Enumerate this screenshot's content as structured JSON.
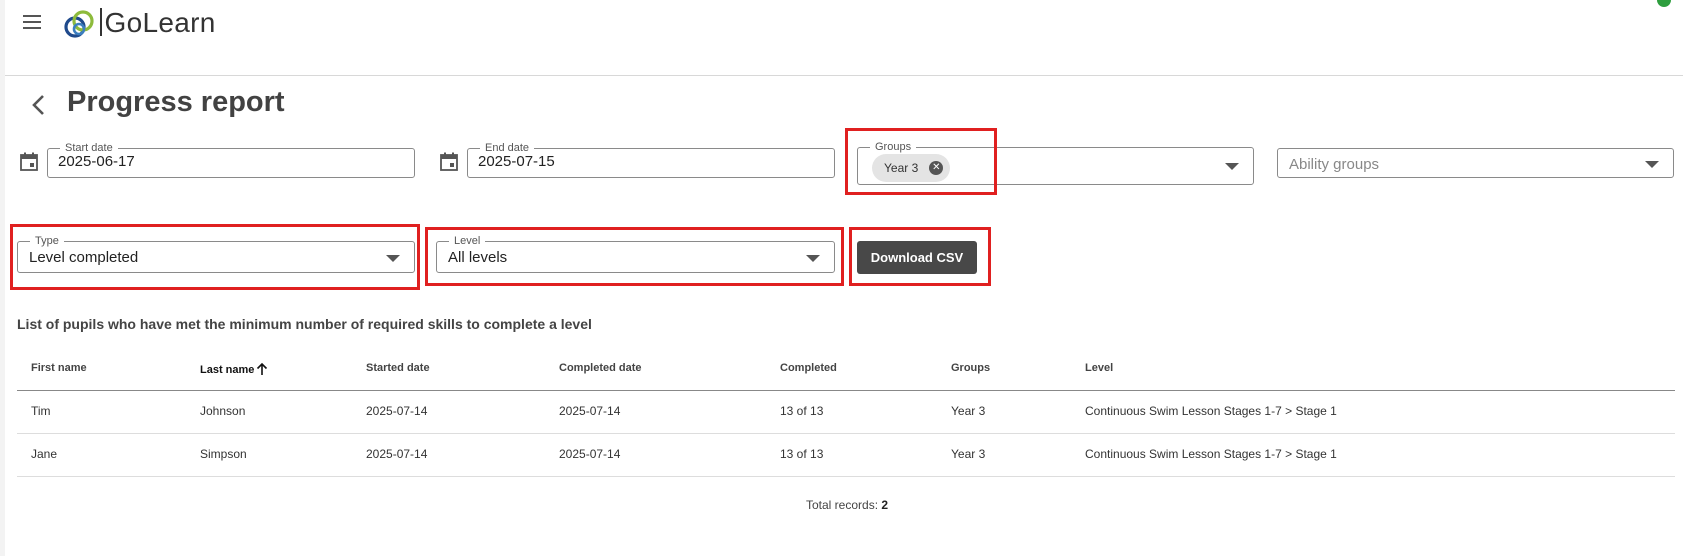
{
  "app": {
    "logo_text": "GoLearn",
    "accent_color": "#e02020",
    "status_color": "#2e9e3e"
  },
  "header": {
    "menu_icon": "hamburger-menu-icon",
    "back_icon": "chevron-left-icon",
    "title": "Progress report"
  },
  "filters": {
    "start_date": {
      "label": "Start date",
      "value": "2025-06-17",
      "icon": "calendar-icon"
    },
    "end_date": {
      "label": "End date",
      "value": "2025-07-15",
      "icon": "calendar-icon"
    },
    "groups": {
      "label": "Groups",
      "chips": [
        "Year 3"
      ]
    },
    "ability_groups": {
      "placeholder": "Ability groups"
    },
    "type": {
      "label": "Type",
      "value": "Level completed"
    },
    "level": {
      "label": "Level",
      "value": "All levels"
    },
    "download_label": "Download CSV"
  },
  "report": {
    "description": "List of pupils who have met the minimum number of required skills to complete a level",
    "columns": [
      "First name",
      "Last name",
      "Started date",
      "Completed date",
      "Completed",
      "Groups",
      "Level"
    ],
    "sorted_column": "Last name",
    "rows": [
      [
        "Tim",
        "Johnson",
        "2025-07-14",
        "2025-07-14",
        "13 of 13",
        "Year 3",
        "Continuous Swim Lesson Stages 1-7 > Stage 1"
      ],
      [
        "Jane",
        "Simpson",
        "2025-07-14",
        "2025-07-14",
        "13 of 13",
        "Year 3",
        "Continuous Swim Lesson Stages 1-7 > Stage 1"
      ]
    ],
    "total_label": "Total records:",
    "total_value": "2"
  }
}
